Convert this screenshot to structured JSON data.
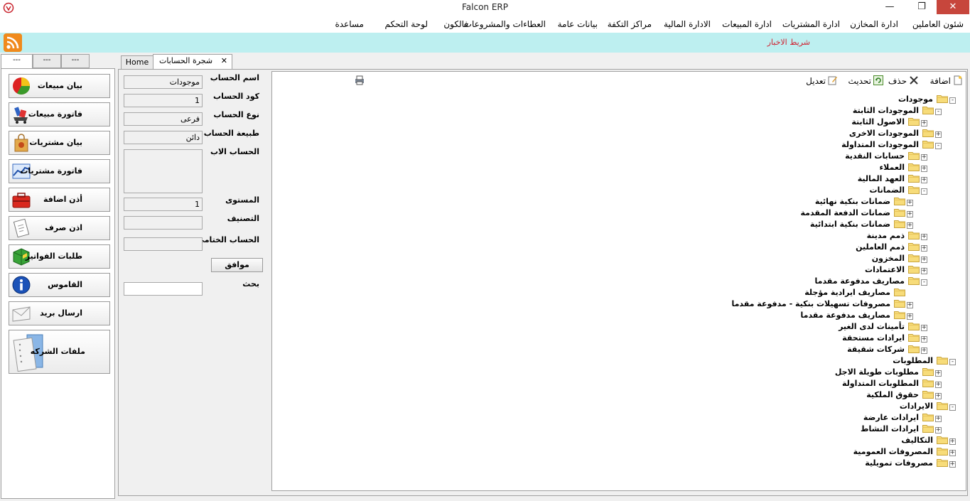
{
  "window": {
    "title": "Falcon ERP",
    "minimize": "—",
    "restore": "❐",
    "close": "✕"
  },
  "menu": [
    "شئون العاملين",
    "ادارة المخازن",
    "ادارة المشتريات",
    "ادارة المبيعات",
    "الادارة المالية",
    "مراكز التكفة",
    "بيانات عامة",
    "العطاءات والمشروعات",
    "فالكون",
    "لوحة التحكم",
    "مساعدة"
  ],
  "news": {
    "label": "شريط الاخبار"
  },
  "left_tabs": [
    "---",
    "---",
    "---"
  ],
  "nav_buttons": [
    {
      "label": "بيان مبيعات",
      "icon": "pie-chart-icon"
    },
    {
      "label": "فاتورة مبيعات",
      "icon": "cart-icon"
    },
    {
      "label": "بيان مشتريات",
      "icon": "shopping-bag-icon"
    },
    {
      "label": "فاتورة مشتريات",
      "icon": "line-chart-icon"
    },
    {
      "label": "أذن اضافة",
      "icon": "toolbox-icon"
    },
    {
      "label": "اذن صرف",
      "icon": "clipboard-icon"
    },
    {
      "label": "طلبات الفواتير",
      "icon": "green-box-icon"
    },
    {
      "label": "القاموس",
      "icon": "info-icon"
    },
    {
      "label": "ارسال بريد",
      "icon": "envelope-icon"
    },
    {
      "label": "ملفات الشركه",
      "icon": "documents-icon"
    }
  ],
  "tabs": {
    "home": "Home",
    "accounts": "شجرة الحسابات",
    "close": "✕"
  },
  "form": {
    "account_name_label": "اسم الحساب",
    "account_name": "موجودات",
    "account_code_label": "كود الحساب",
    "account_code": "1",
    "account_type_label": "نوع الحساب",
    "account_type": "فرعى",
    "account_nature_label": "طبيعة الحساب",
    "account_nature": "دائن",
    "parent_label": "الحساب الاب",
    "level_label": "المستوى",
    "level": "1",
    "classification_label": "التصنيف",
    "final_account_label": "الحساب الختامى",
    "ok_label": "موافق",
    "search_label": "بحث"
  },
  "toolbar": {
    "add": "اضافة",
    "delete": "حذف",
    "refresh": "تحديث",
    "edit": "تعديل"
  },
  "tree": [
    {
      "text": "موجودات",
      "level": 0,
      "exp": "-"
    },
    {
      "text": "الموجودات الثابتة",
      "level": 1,
      "exp": "-"
    },
    {
      "text": "الاصول الثابتة",
      "level": 2,
      "exp": "+"
    },
    {
      "text": "الموجودات الاخرى",
      "level": 1,
      "exp": "+"
    },
    {
      "text": "الموجودات المتداولة",
      "level": 1,
      "exp": "-"
    },
    {
      "text": "حسابات النقدية",
      "level": 2,
      "exp": "+"
    },
    {
      "text": "العملاء",
      "level": 2,
      "exp": "+"
    },
    {
      "text": "العهد المالية",
      "level": 2,
      "exp": "+"
    },
    {
      "text": "الضمانات",
      "level": 2,
      "exp": "-"
    },
    {
      "text": "ضمانات بنكية نهائية",
      "level": 3,
      "exp": "+"
    },
    {
      "text": "ضمانات الدفعة المقدمة",
      "level": 3,
      "exp": "+"
    },
    {
      "text": "ضمانات بنكية ابتدائية",
      "level": 3,
      "exp": "+"
    },
    {
      "text": "ذمم مدينة",
      "level": 2,
      "exp": "+"
    },
    {
      "text": "ذمم العاملين",
      "level": 2,
      "exp": "+"
    },
    {
      "text": "المخزون",
      "level": 2,
      "exp": "+"
    },
    {
      "text": "الاعتمادات",
      "level": 2,
      "exp": "+"
    },
    {
      "text": "مصاريف مدفوعة مقدما",
      "level": 2,
      "exp": "-"
    },
    {
      "text": "مصاريف ايرادية مؤجلة",
      "level": 3,
      "exp": ""
    },
    {
      "text": "مصروفات تسهيلات بنكية - مدفوعة مقدما",
      "level": 3,
      "exp": "+"
    },
    {
      "text": "مصاريف مدفوعة مقدما",
      "level": 3,
      "exp": "+"
    },
    {
      "text": "تأمينات لدى الغير",
      "level": 2,
      "exp": "+"
    },
    {
      "text": "ايرادات مستحقة",
      "level": 2,
      "exp": "+"
    },
    {
      "text": "شركات شقيقة",
      "level": 2,
      "exp": "+"
    },
    {
      "text": "المطلوبات",
      "level": 0,
      "exp": "-"
    },
    {
      "text": "مطلوبات طويلة الاجل",
      "level": 1,
      "exp": "+"
    },
    {
      "text": "المطلوبات المتداولة",
      "level": 1,
      "exp": "+"
    },
    {
      "text": "حقوق الملكية",
      "level": 1,
      "exp": "+"
    },
    {
      "text": "الايرادات",
      "level": 0,
      "exp": "-"
    },
    {
      "text": "ايرادات عارضة",
      "level": 1,
      "exp": "+"
    },
    {
      "text": "ايرادات النشاط",
      "level": 1,
      "exp": "+"
    },
    {
      "text": "التكاليف",
      "level": 0,
      "exp": "+"
    },
    {
      "text": "المصروفات العمومية",
      "level": 0,
      "exp": "+"
    },
    {
      "text": "مصروفات تمويلية",
      "level": 0,
      "exp": "+"
    }
  ]
}
